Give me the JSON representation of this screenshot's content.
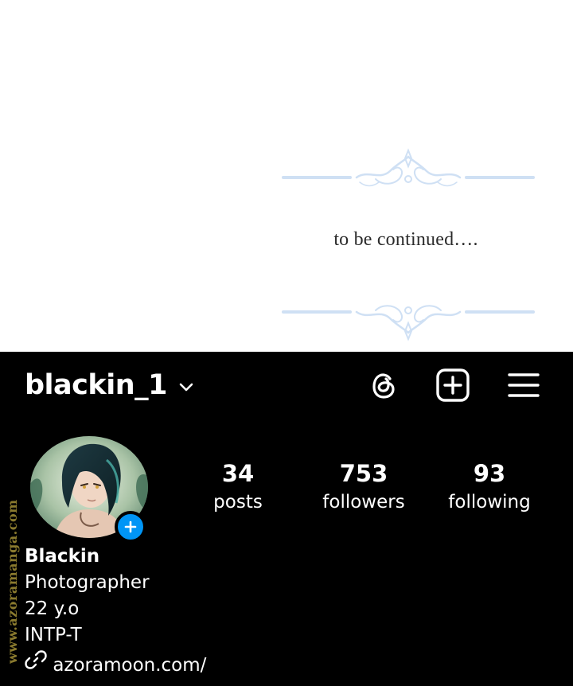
{
  "panel": {
    "caption": "to be continued….",
    "ornament_color": "#cfe0f4"
  },
  "profile": {
    "username": "blackin_1",
    "icons": {
      "username_dropdown": "chevron-down-icon",
      "threads": "threads-icon",
      "new_post": "add-square-icon",
      "menu": "hamburger-menu-icon",
      "avatar_add": "plus-icon",
      "link": "link-icon"
    },
    "stats": [
      {
        "value": "34",
        "label": "posts"
      },
      {
        "value": "753",
        "label": "followers"
      },
      {
        "value": "93",
        "label": "following"
      }
    ],
    "bio": {
      "name": "Blackin",
      "lines": [
        "Photographer",
        "22 y.o",
        "INTP-T"
      ],
      "link": "azoramoon.com/"
    },
    "accent_color": "#0095f6",
    "background_color": "#000000"
  },
  "watermark": "www.azoramanga.com"
}
